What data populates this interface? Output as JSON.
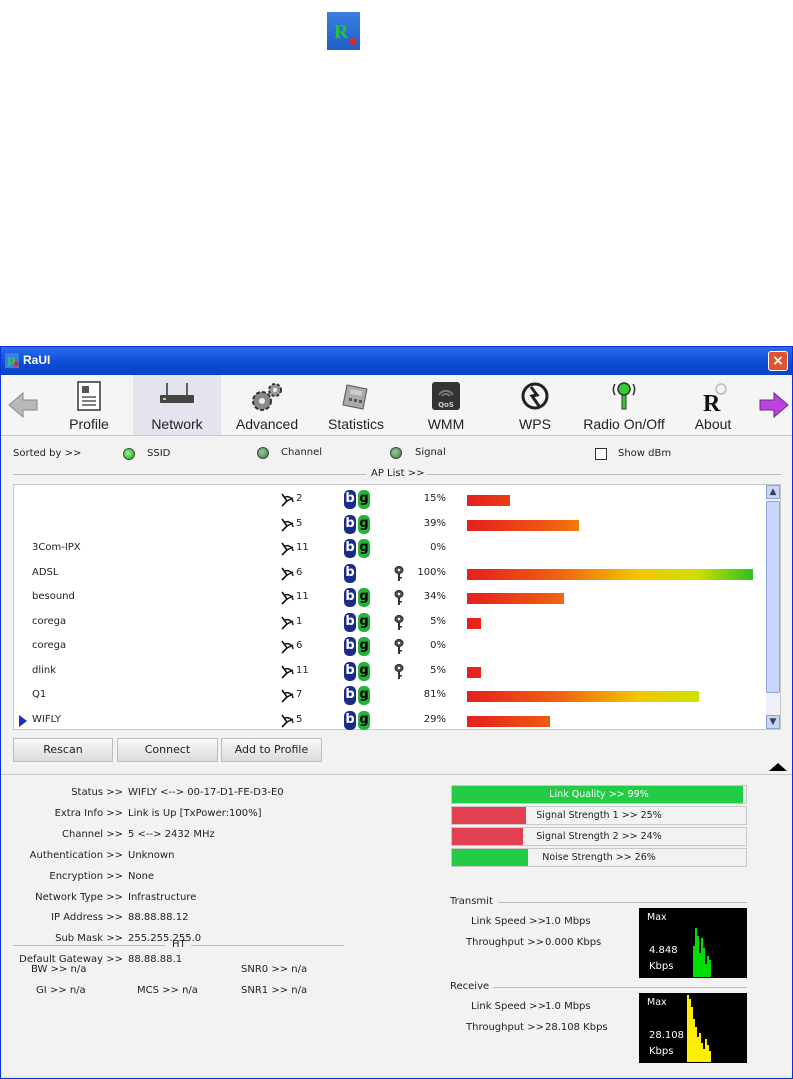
{
  "window": {
    "title": "RaUI",
    "close_glyph": "×"
  },
  "toolbar": {
    "items": [
      {
        "label": "Profile",
        "icon": "profile-icon"
      },
      {
        "label": "Network",
        "icon": "network-icon"
      },
      {
        "label": "Advanced",
        "icon": "advanced-icon"
      },
      {
        "label": "Statistics",
        "icon": "statistics-icon"
      },
      {
        "label": "WMM",
        "icon": "wmm-icon",
        "icon_text": "QoS"
      },
      {
        "label": "WPS",
        "icon": "wps-icon"
      },
      {
        "label": "Radio On/Off",
        "icon": "radio-icon"
      },
      {
        "label": "About",
        "icon": "about-icon",
        "icon_text": "R"
      }
    ],
    "active": "Network"
  },
  "sort": {
    "label": "Sorted by >>",
    "options": [
      "SSID",
      "Channel",
      "Signal"
    ],
    "show_dbm": "Show dBm"
  },
  "aplist": {
    "title": "AP List >>",
    "rows": [
      {
        "ssid": "",
        "channel": "2",
        "b": true,
        "g": true,
        "lock": false,
        "signal": 15
      },
      {
        "ssid": "",
        "channel": "5",
        "b": true,
        "g": true,
        "lock": false,
        "signal": 39
      },
      {
        "ssid": "3Com-IPX",
        "channel": "11",
        "b": true,
        "g": true,
        "lock": false,
        "signal": 0
      },
      {
        "ssid": "ADSL",
        "channel": "6",
        "b": true,
        "g": false,
        "lock": true,
        "signal": 100
      },
      {
        "ssid": "besound",
        "channel": "11",
        "b": true,
        "g": true,
        "lock": true,
        "signal": 34
      },
      {
        "ssid": "corega",
        "channel": "1",
        "b": true,
        "g": true,
        "lock": true,
        "signal": 5
      },
      {
        "ssid": "corega",
        "channel": "6",
        "b": true,
        "g": true,
        "lock": true,
        "signal": 0
      },
      {
        "ssid": "dlink",
        "channel": "11",
        "b": true,
        "g": true,
        "lock": true,
        "signal": 5
      },
      {
        "ssid": "Q1",
        "channel": "7",
        "b": true,
        "g": true,
        "lock": false,
        "signal": 81
      },
      {
        "ssid": "WIFLY",
        "channel": "5",
        "b": true,
        "g": true,
        "lock": false,
        "signal": 29,
        "selected": true
      }
    ],
    "badge_b": "b",
    "badge_g": "g",
    "pct_suffix": "%"
  },
  "buttons": {
    "rescan": "Rescan",
    "connect": "Connect",
    "add_profile": "Add to Profile"
  },
  "status": {
    "rows": [
      {
        "label": "Status >>",
        "value": "WIFLY <--> 00-17-D1-FE-D3-E0"
      },
      {
        "label": "Extra Info >>",
        "value": "Link is Up [TxPower:100%]"
      },
      {
        "label": "Channel >>",
        "value": "5 <--> 2432 MHz"
      },
      {
        "label": "Authentication >>",
        "value": "Unknown"
      },
      {
        "label": "Encryption >>",
        "value": "None"
      },
      {
        "label": "Network Type >>",
        "value": "Infrastructure"
      },
      {
        "label": "IP Address >>",
        "value": "88.88.88.12"
      },
      {
        "label": "Sub Mask >>",
        "value": "255.255.255.0"
      },
      {
        "label": "Default Gateway >>",
        "value": "88.88.88.1"
      }
    ]
  },
  "ht": {
    "title": "HT",
    "bw": "BW >> n/a",
    "gi": "GI >> n/a",
    "mcs": "MCS >> n/a",
    "snr0": "SNR0 >> n/a",
    "snr1": "SNR1 >> n/a"
  },
  "quality": {
    "link_quality": {
      "text": "Link Quality >> 99%",
      "value": 99,
      "color": "#22cc44"
    },
    "signal1": {
      "text": "Signal Strength 1 >> 25%",
      "value": 25,
      "color": "#e04050"
    },
    "signal2": {
      "text": "Signal Strength 2 >> 24%",
      "value": 24,
      "color": "#e04050"
    },
    "noise": {
      "text": "Noise Strength >> 26%",
      "value": 26,
      "color": "#22cc44"
    }
  },
  "transmit": {
    "title": "Transmit",
    "link_speed_label": "Link Speed >>",
    "link_speed": "1.0 Mbps",
    "throughput_label": "Throughput >>",
    "throughput": "0.000 Kbps",
    "graph_max": "Max",
    "graph_value": "4.848",
    "graph_unit": "Kbps",
    "graph_color": "#00dd00"
  },
  "receive": {
    "title": "Receive",
    "link_speed_label": "Link Speed >>",
    "link_speed": "1.0 Mbps",
    "throughput_label": "Throughput >>",
    "throughput": "28.108 Kbps",
    "graph_max": "Max",
    "graph_value": "28.108",
    "graph_unit": "Kbps",
    "graph_color": "#ffee00"
  }
}
